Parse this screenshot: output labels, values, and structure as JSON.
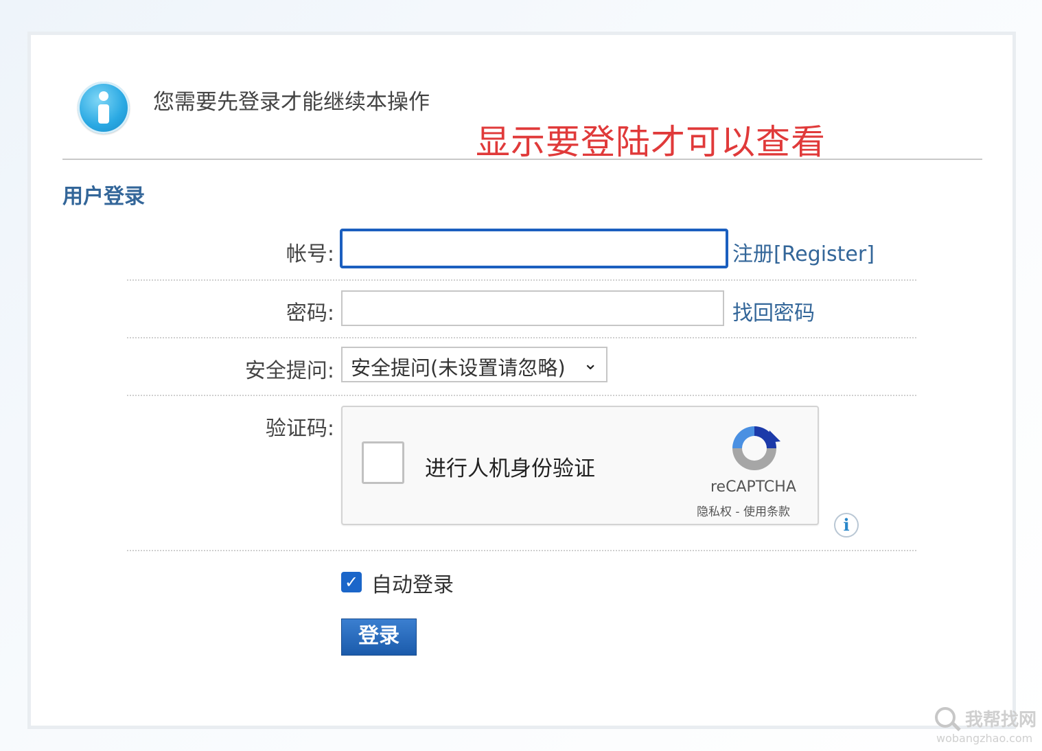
{
  "notice": {
    "message": "您需要先登录才能继续本操作",
    "annotation": "显示要登陆才可以查看",
    "icon": "info-icon"
  },
  "section_title": "用户登录",
  "form": {
    "account_label": "帐号:",
    "register_link": "注册[Register]",
    "password_label": "密码:",
    "forgot_link": "找回密码",
    "security_label": "安全提问:",
    "security_selected": "安全提问(未设置请忽略)",
    "captcha_label": "验证码:",
    "captcha_prompt": "进行人机身份验证",
    "captcha_brand": "reCAPTCHA",
    "captcha_terms": "隐私权 - 使用条款",
    "autologin_label": "自动登录",
    "autologin_checked": true,
    "login_button": "登录"
  },
  "colors": {
    "accent": "#336699",
    "annotation": "#e03a3a",
    "focus_border": "#1b5fbf",
    "button": "#1b5bab"
  },
  "watermark": {
    "text": "我帮找网",
    "url": "wobangzhao.com"
  }
}
